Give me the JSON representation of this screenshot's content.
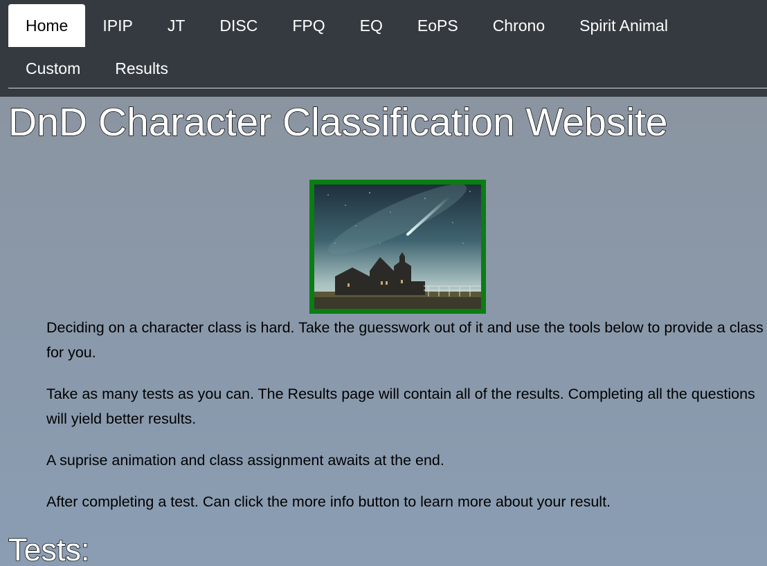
{
  "nav": {
    "tabs_row1": [
      {
        "label": "Home",
        "active": true
      },
      {
        "label": "IPIP"
      },
      {
        "label": "JT"
      },
      {
        "label": "DISC"
      },
      {
        "label": "FPQ"
      },
      {
        "label": "EQ"
      },
      {
        "label": "EoPS"
      },
      {
        "label": "Chrono"
      },
      {
        "label": "Spirit Animal"
      }
    ],
    "tabs_row2": [
      {
        "label": "Custom"
      },
      {
        "label": "Results"
      }
    ]
  },
  "page": {
    "title": "DnD Character Classification Website",
    "hero_image": "night-sky-church-photo",
    "paragraphs": [
      "Deciding on a character class is hard. Take the guesswork out of it and use the tools below to provide a class for you.",
      "Take as many tests as you can. The Results page will contain all of the results. Completing all the questions will yield better results.",
      "A suprise animation and class assignment awaits at the end.",
      "After completing a test. Can click the more info button to learn more about your result."
    ],
    "tests_heading": "Tests:"
  },
  "colors": {
    "navbar_bg": "#343a40",
    "image_border": "#0a7d13"
  }
}
